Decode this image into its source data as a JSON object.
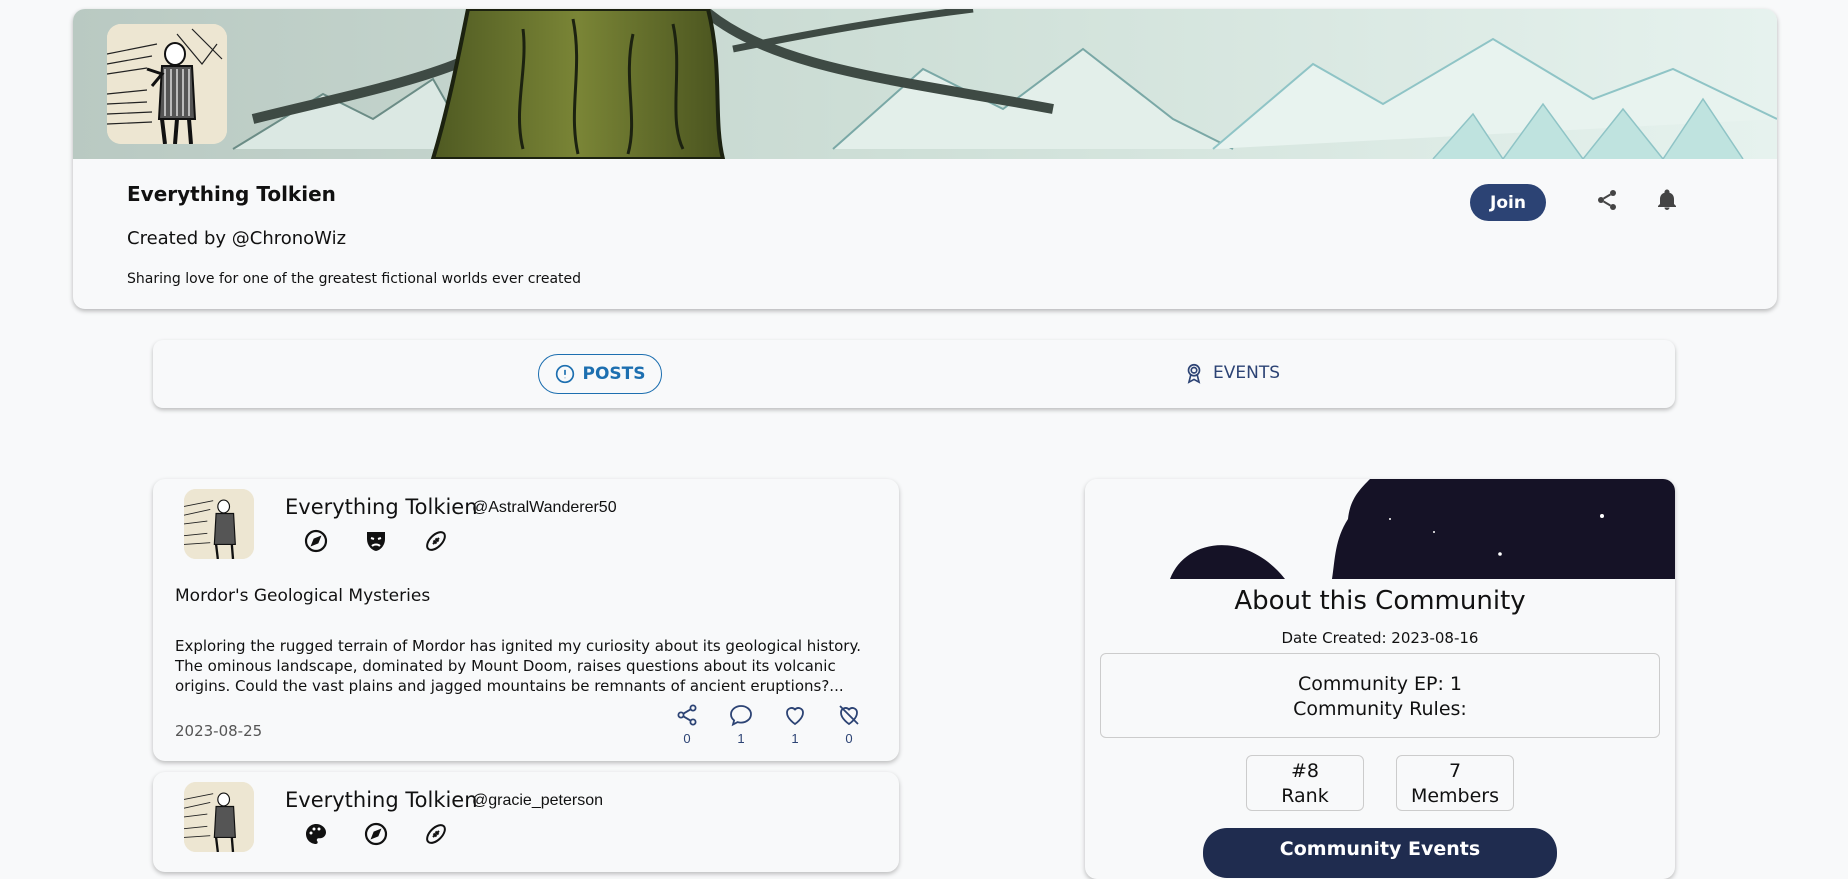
{
  "header": {
    "community_name": "Everything Tolkien",
    "created_by": "Created by @ChronoWiz",
    "description": "Sharing love for one of the greatest fictional worlds ever created",
    "join_label": "Join"
  },
  "tabs": [
    {
      "label": "POSTS",
      "active": true
    },
    {
      "label": "EVENTS",
      "active": false
    }
  ],
  "posts": [
    {
      "community": "Everything Tolkien",
      "handle": "@AstralWanderer50",
      "badges": [
        "compass-icon",
        "theater-mask-icon",
        "football-icon"
      ],
      "title": "Mordor's Geological Mysteries",
      "body_lines": [
        "Exploring the rugged terrain of Mordor has ignited my curiosity about its geological history.",
        "The ominous landscape, dominated by Mount Doom, raises questions about its volcanic",
        "origins. Could the vast plains and jagged mountains be remnants of ancient eruptions?..."
      ],
      "date": "2023-08-25",
      "actions": {
        "share": "0",
        "comments": "1",
        "likes": "1",
        "dislikes": "0"
      }
    },
    {
      "community": "Everything Tolkien",
      "handle": "@gracie_peterson",
      "badges": [
        "palette-icon",
        "compass-icon",
        "football-icon"
      ]
    }
  ],
  "about": {
    "title": "About this Community",
    "date_created": "Date Created: 2023-08-16",
    "ep": "Community EP: 1",
    "rules": "Community Rules:",
    "rank_value": "#8",
    "rank_label": "Rank",
    "members_value": "7",
    "members_label": "Members",
    "events_button": "Community Events"
  },
  "colors": {
    "primary": "#2c4374",
    "accent_blue": "#1d6fb0",
    "dark_navy": "#1f2c4f",
    "background": "#f8f9fa"
  }
}
